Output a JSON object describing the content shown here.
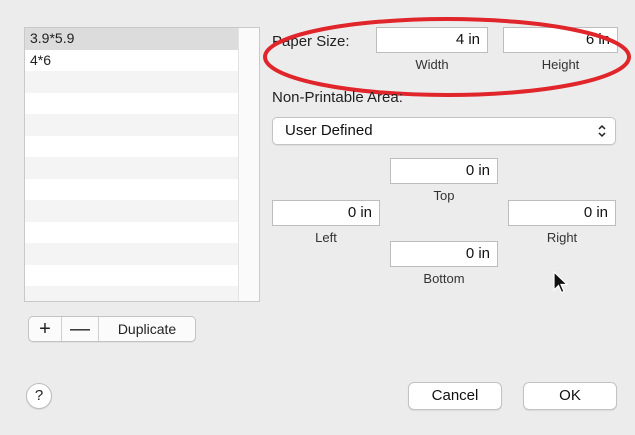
{
  "paper_list": {
    "items": [
      "3.9*5.9",
      "4*6"
    ]
  },
  "list_controls": {
    "add_label": "+",
    "remove_label": "—",
    "duplicate_label": "Duplicate"
  },
  "paper_size": {
    "label": "Paper Size:",
    "width_value": "4 in",
    "height_value": "6 in",
    "width_caption": "Width",
    "height_caption": "Height"
  },
  "non_printable": {
    "label": "Non-Printable Area:",
    "selected": "User Defined",
    "top_value": "0 in",
    "left_value": "0 in",
    "right_value": "0 in",
    "bottom_value": "0 in",
    "top_caption": "Top",
    "left_caption": "Left",
    "right_caption": "Right",
    "bottom_caption": "Bottom"
  },
  "footer": {
    "help_label": "?",
    "cancel_label": "Cancel",
    "ok_label": "OK"
  },
  "colors": {
    "annotation": "#e0252b",
    "window_bg": "#ececec"
  }
}
